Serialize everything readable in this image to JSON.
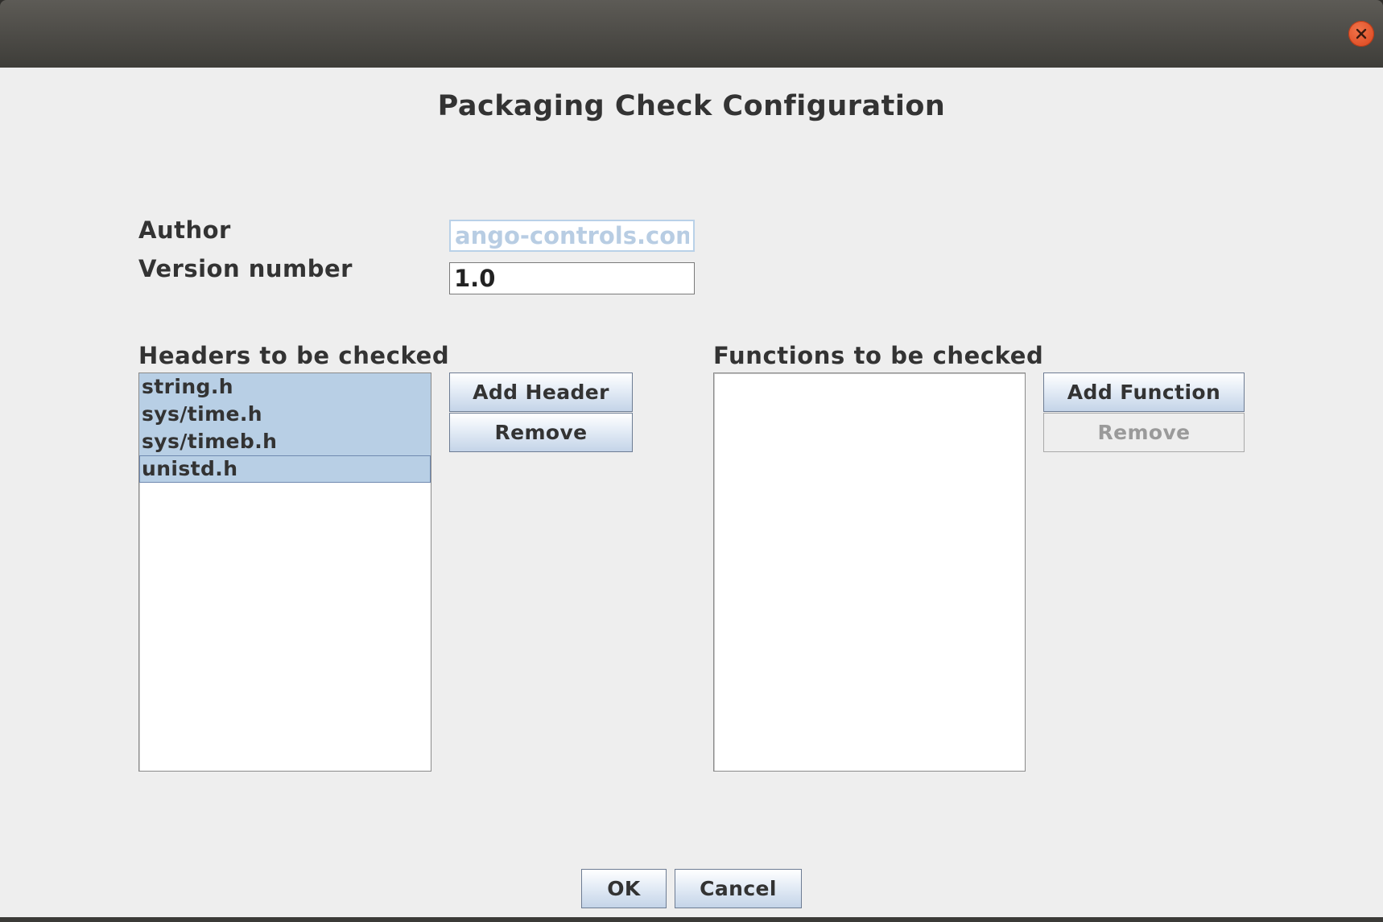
{
  "window": {
    "close_icon": "close-icon",
    "close_color": "#e2512a"
  },
  "dialog": {
    "title": "Packaging Check Configuration"
  },
  "form": {
    "author_label": "Author",
    "author_value": "ango-controls.com",
    "version_label": "Version number",
    "version_value": "1.0"
  },
  "headers": {
    "label": "Headers to be checked",
    "items": [
      "string.h",
      "sys/time.h",
      "sys/timeb.h",
      "unistd.h"
    ],
    "add_label": "Add Header",
    "remove_label": "Remove"
  },
  "functions": {
    "label": "Functions to be checked",
    "items": [],
    "add_label": "Add Function",
    "remove_label": "Remove"
  },
  "footer": {
    "ok_label": "OK",
    "cancel_label": "Cancel"
  },
  "colors": {
    "selection": "#b8cfe5",
    "dialog_bg": "#eeeeee",
    "titlebar": "#4a4844"
  }
}
